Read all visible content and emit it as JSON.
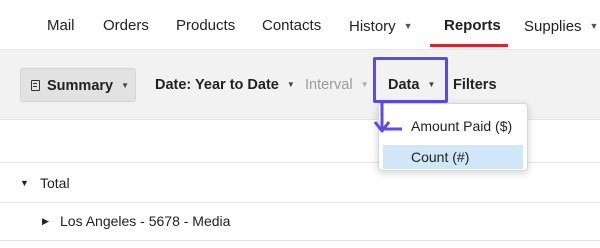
{
  "nav": {
    "items": [
      {
        "label": "Mail",
        "caret": false
      },
      {
        "label": "Orders",
        "caret": false
      },
      {
        "label": "Products",
        "caret": false
      },
      {
        "label": "Contacts",
        "caret": false
      },
      {
        "label": "History",
        "caret": true
      },
      {
        "label": "Reports",
        "caret": false,
        "active": true
      },
      {
        "label": "Supplies",
        "caret": true
      }
    ],
    "active_color": "#d9262c"
  },
  "toolbar": {
    "summary_label": "Summary",
    "date_label": "Date: Year to Date",
    "interval_label": "Interval",
    "data_label": "Data",
    "filters_label": "Filters",
    "highlight_color": "#5b4be8"
  },
  "data_menu": {
    "options": [
      {
        "label": "Amount Paid ($)",
        "selected": false
      },
      {
        "label": "Count (#)",
        "selected": true
      }
    ]
  },
  "rows": [
    {
      "label": "Total",
      "expanded": true
    },
    {
      "label": "Los Angeles - 5678 - Media",
      "expanded": false
    }
  ]
}
